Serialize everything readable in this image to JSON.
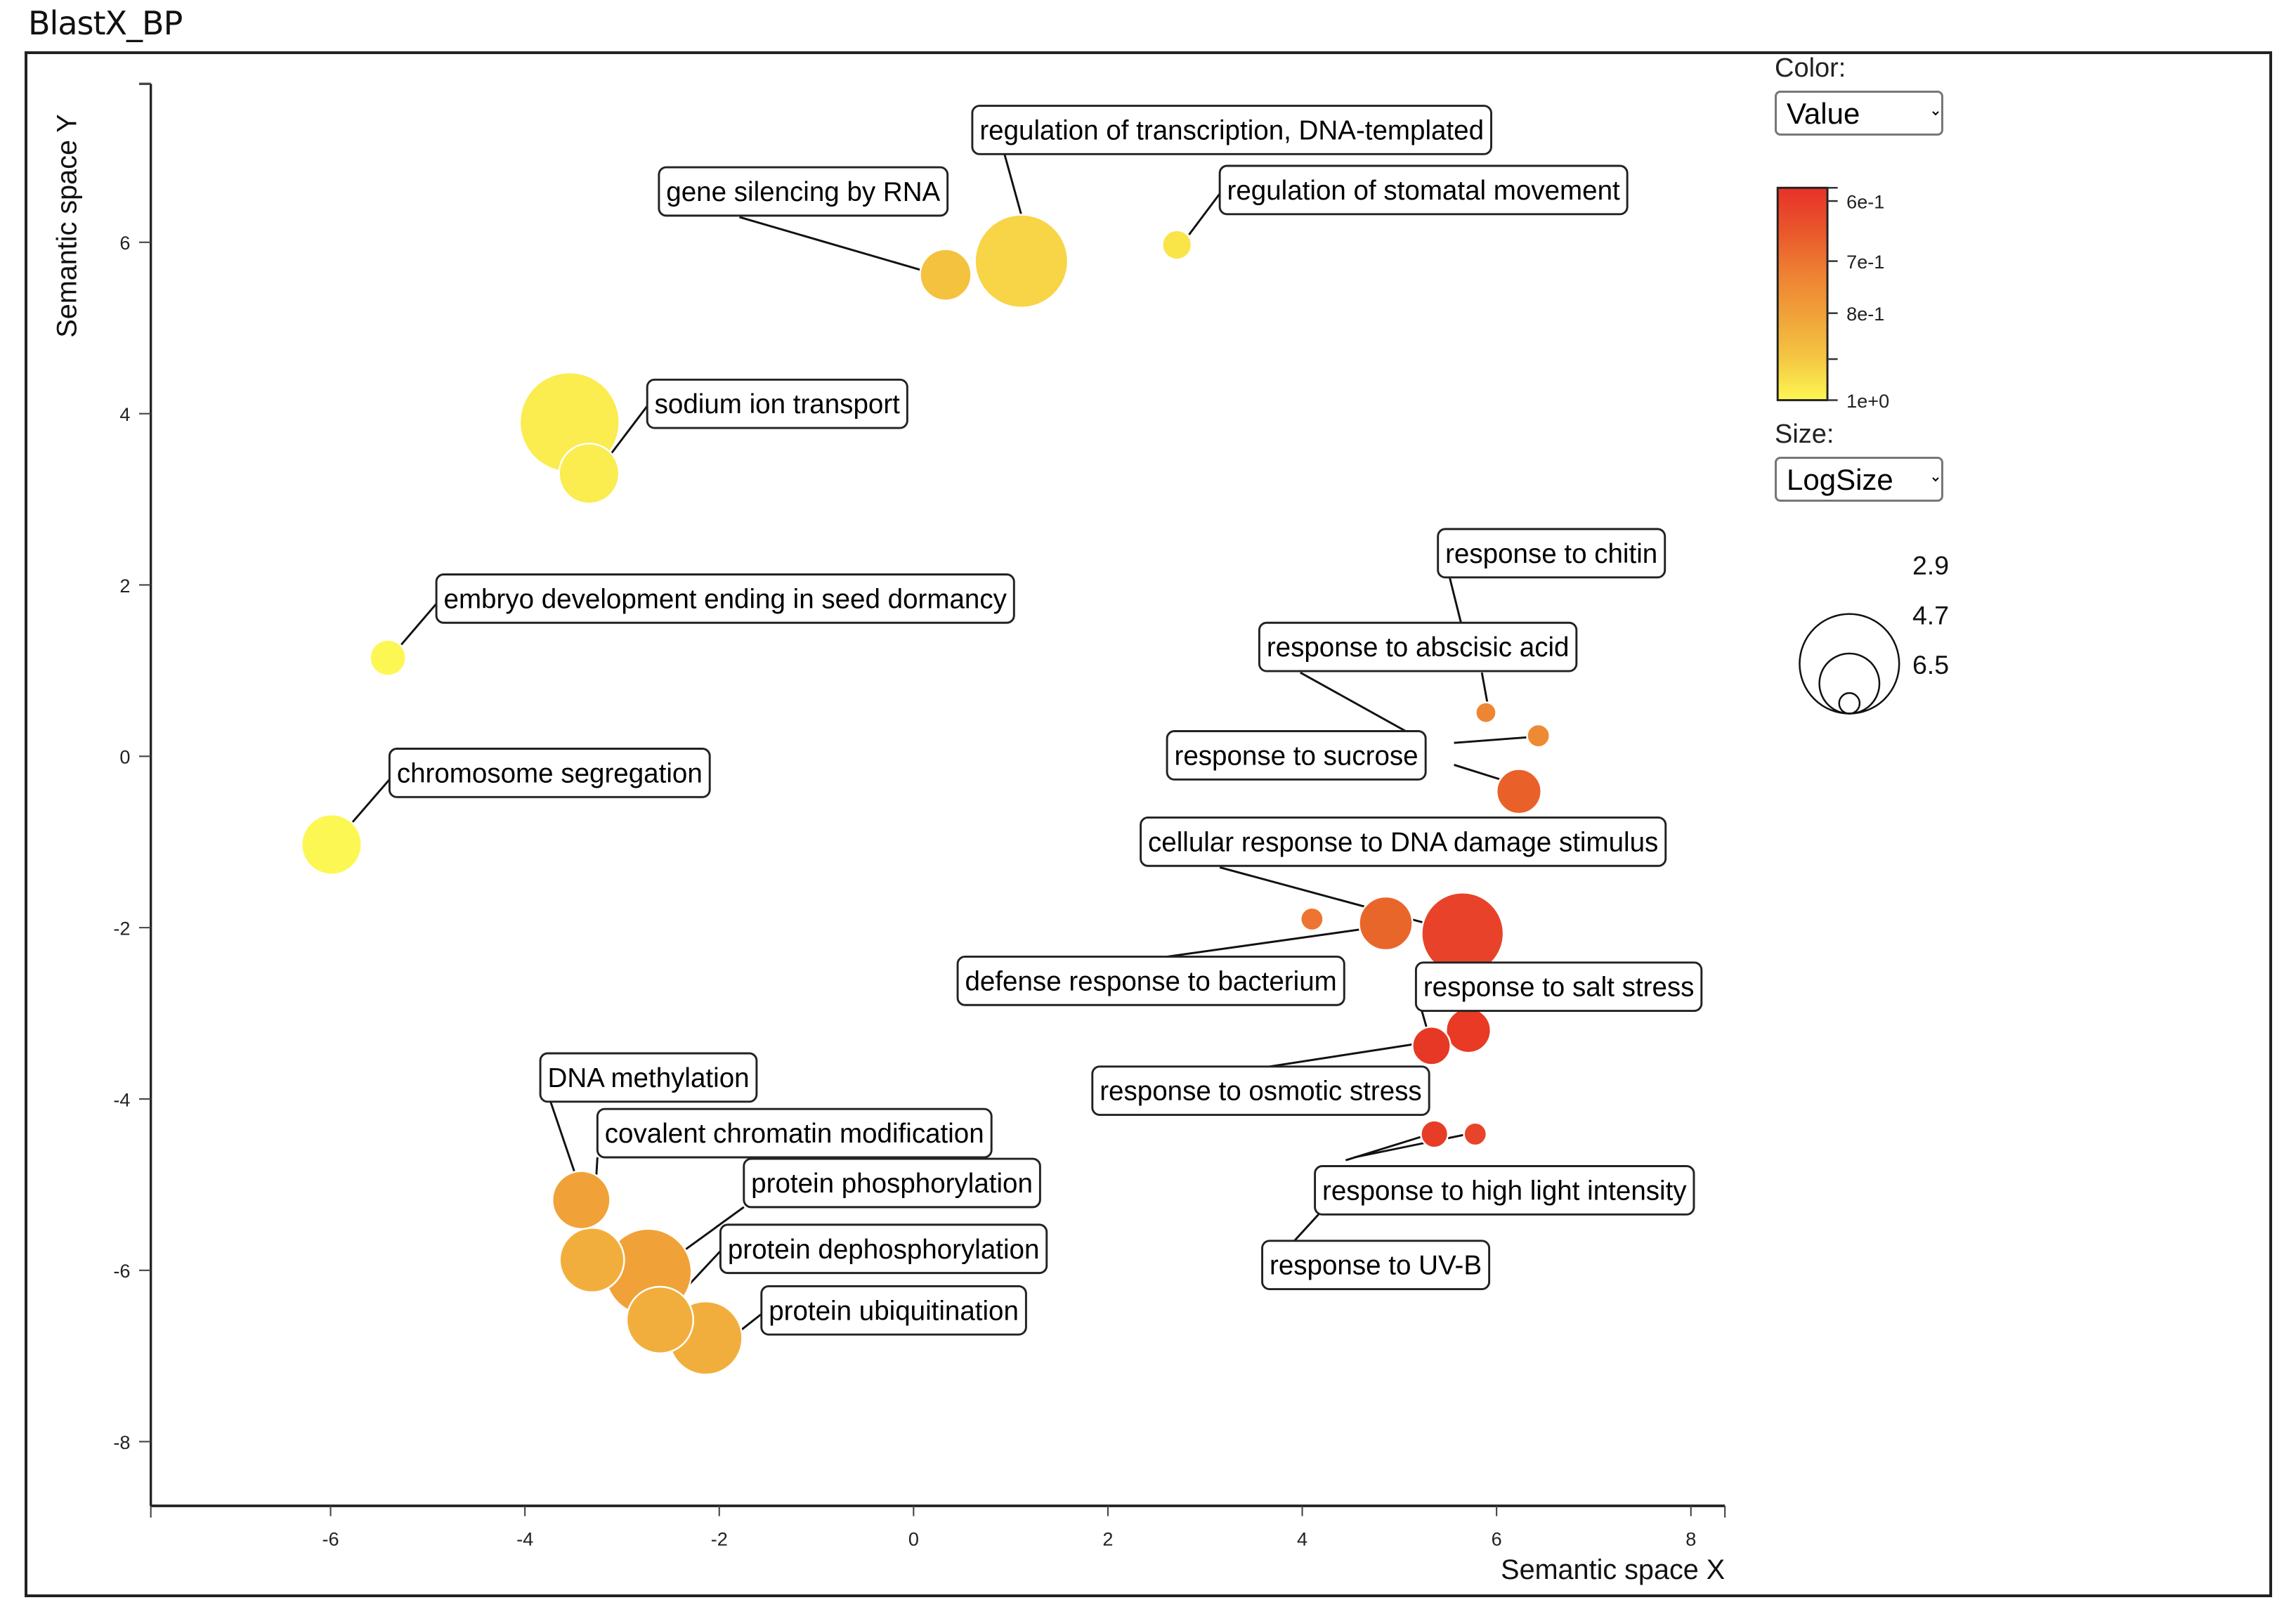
{
  "page": {
    "title": "BlastX_BP"
  },
  "controls": {
    "color_label": "Color:",
    "color_selected": "Value",
    "size_label": "Size:",
    "size_selected": "LogSize"
  },
  "chart_data": {
    "type": "scatter",
    "subtype": "bubble",
    "title": "BlastX_BP",
    "xlabel": "Semantic space X",
    "ylabel": "Semantic space Y",
    "xlim": [
      -7.85,
      8.35
    ],
    "ylim": [
      -8.75,
      7.85
    ],
    "x_ticks": [
      -6,
      -4,
      -2,
      0,
      2,
      4,
      6,
      8
    ],
    "y_ticks": [
      6,
      4,
      2,
      0,
      -2,
      -4,
      -6,
      -8
    ],
    "grid": false,
    "color_legend": {
      "title": "Value",
      "placement": "top-right",
      "scale": "log",
      "min_value": 0.58,
      "max_value": 1.0,
      "min_color": "#e8312a",
      "max_color": "#fdf753",
      "ticks": [
        {
          "value": 0.58,
          "label": ""
        },
        {
          "value": 0.6,
          "label": "6e-1"
        },
        {
          "value": 0.7,
          "label": "7e-1"
        },
        {
          "value": 0.8,
          "label": "8e-1"
        },
        {
          "value": 0.9,
          "label": ""
        },
        {
          "value": 1.0,
          "label": "1e+0"
        }
      ],
      "gradient_stops": [
        "#e8312a",
        "#e9562b",
        "#ee8033",
        "#f0a239",
        "#f4c642",
        "#fdf753"
      ]
    },
    "size_legend": {
      "title": "LogSize",
      "placement": "right",
      "entries": [
        {
          "value": 2.9,
          "label": "2.9"
        },
        {
          "value": 4.7,
          "label": "4.7"
        },
        {
          "value": 6.5,
          "label": "6.5"
        }
      ]
    },
    "points": [
      {
        "term": "regulation of transcription, DNA-templated",
        "x": 1.11,
        "y": 5.78,
        "log_size": 6.2,
        "value": 0.92,
        "color": "#f8d447",
        "labeled": true
      },
      {
        "term": "gene silencing by RNA",
        "x": 0.33,
        "y": 5.62,
        "log_size": 4.3,
        "value": 0.88,
        "color": "#f4c23f",
        "labeled": true
      },
      {
        "term": "regulation of stomatal movement",
        "x": 2.71,
        "y": 5.97,
        "log_size": 3.3,
        "value": 0.96,
        "color": "#fae549",
        "labeled": true
      },
      {
        "term": "sodium ion transport",
        "x": -3.54,
        "y": 3.9,
        "log_size": 6.5,
        "value": 0.98,
        "color": "#fbec4f",
        "labeled": true
      },
      {
        "term": "",
        "x": -3.34,
        "y": 3.3,
        "log_size": 4.7,
        "value": 0.98,
        "color": "#fbec4f",
        "labeled": false
      },
      {
        "term": "embryo development ending in seed dormancy",
        "x": -5.41,
        "y": 1.15,
        "log_size": 3.6,
        "value": 1.0,
        "color": "#fdf753",
        "labeled": true
      },
      {
        "term": "chromosome segregation",
        "x": -5.99,
        "y": -1.03,
        "log_size": 4.7,
        "value": 1.0,
        "color": "#fdf753",
        "labeled": true
      },
      {
        "term": "response to chitin",
        "x": 5.89,
        "y": 0.51,
        "log_size": 2.9,
        "value": 0.74,
        "color": "#ee8533",
        "labeled": true
      },
      {
        "term": "response to abscisic acid",
        "x": 6.43,
        "y": 0.24,
        "log_size": 3.0,
        "value": 0.75,
        "color": "#ee8a33",
        "labeled": true
      },
      {
        "term": "response to sucrose",
        "x": 6.23,
        "y": -0.41,
        "log_size": 4.0,
        "value": 0.67,
        "color": "#e96129",
        "labeled": true
      },
      {
        "term": "",
        "x": 4.1,
        "y": -1.9,
        "log_size": 3.0,
        "value": 0.71,
        "color": "#ee7531",
        "labeled": false
      },
      {
        "term": "defense response to bacterium",
        "x": 4.86,
        "y": -1.95,
        "log_size": 4.4,
        "value": 0.68,
        "color": "#e9662b",
        "labeled": true
      },
      {
        "term": "cellular response to DNA damage stimulus",
        "x": 5.65,
        "y": -2.07,
        "log_size": 5.7,
        "value": 0.61,
        "color": "#e8432a",
        "labeled": true
      },
      {
        "term": "response to salt stress",
        "x": 5.71,
        "y": -3.2,
        "log_size": 4.0,
        "value": 0.6,
        "color": "#e83a24",
        "labeled": true
      },
      {
        "term": "response to osmotic stress",
        "x": 5.33,
        "y": -3.38,
        "log_size": 3.7,
        "value": 0.6,
        "color": "#e63825",
        "labeled": true
      },
      {
        "term": "response to high light intensity",
        "x": 5.36,
        "y": -4.41,
        "log_size": 3.2,
        "value": 0.61,
        "color": "#e73d27",
        "labeled": true
      },
      {
        "term": "response to UV-B",
        "x": 5.78,
        "y": -4.41,
        "log_size": 3.0,
        "value": 0.62,
        "color": "#e84429",
        "labeled": true
      },
      {
        "term": "DNA methylation",
        "x": -3.42,
        "y": -5.18,
        "log_size": 4.6,
        "value": 0.82,
        "color": "#f0a238",
        "labeled": true
      },
      {
        "term": "covalent chromatin modification",
        "x": -3.31,
        "y": -5.88,
        "log_size": 4.9,
        "value": 0.84,
        "color": "#f2ae3c",
        "labeled": true
      },
      {
        "term": "protein phosphorylation",
        "x": -2.73,
        "y": -6.02,
        "log_size": 5.9,
        "value": 0.82,
        "color": "#f0a238",
        "labeled": true
      },
      {
        "term": "protein dephosphorylation",
        "x": -2.61,
        "y": -6.58,
        "log_size": 5.0,
        "value": 0.84,
        "color": "#f2ae3c",
        "labeled": true
      },
      {
        "term": "protein ubiquitination",
        "x": -2.14,
        "y": -6.79,
        "log_size": 5.3,
        "value": 0.84,
        "color": "#f2ae3c",
        "labeled": true
      }
    ]
  }
}
